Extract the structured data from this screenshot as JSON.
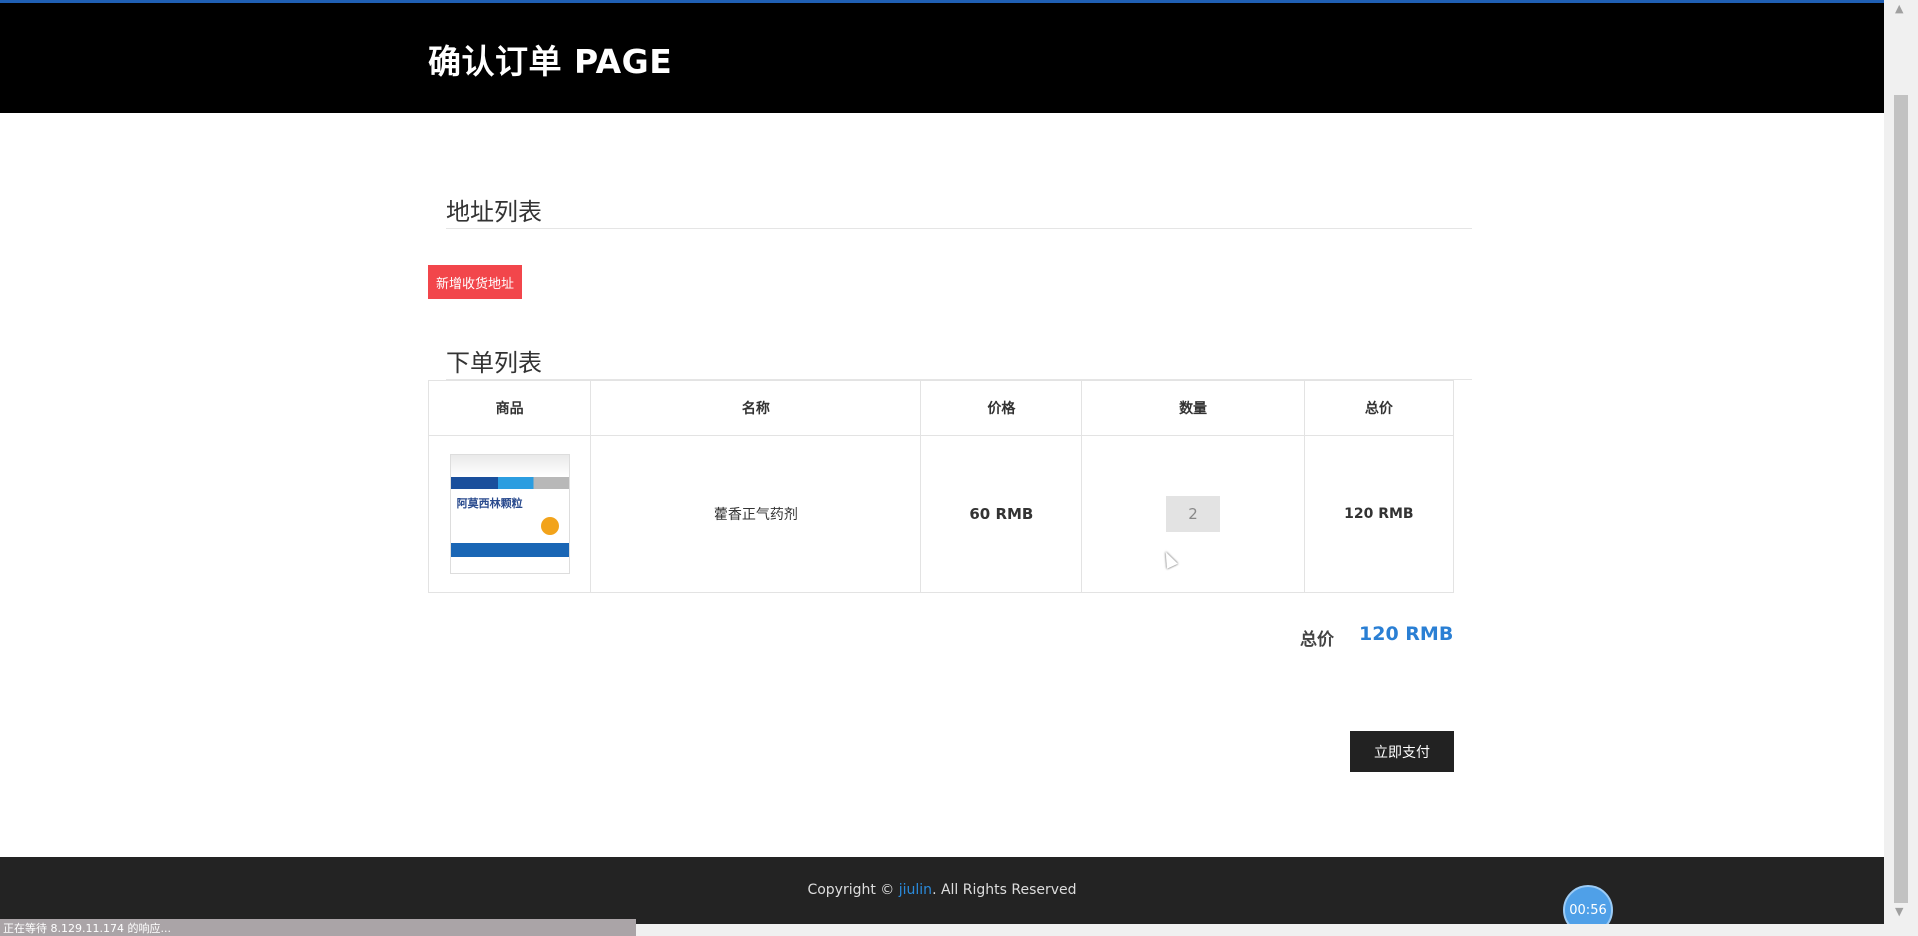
{
  "header": {
    "title": "确认订单 PAGE"
  },
  "address_section": {
    "title": "地址列表",
    "add_button": "新增收货地址"
  },
  "order_section": {
    "title": "下单列表",
    "columns": [
      "商品",
      "名称",
      "价格",
      "数量",
      "总价"
    ],
    "rows": [
      {
        "image_alt": "阿莫西林颗粒",
        "name": "藿香正气药剂",
        "price": "60 RMB",
        "quantity": "2",
        "total": "120 RMB"
      }
    ]
  },
  "summary": {
    "label": "总价",
    "value": "120 RMB"
  },
  "pay_button": "立即支付",
  "footer": {
    "prefix": "Copyright © ",
    "brand": "jiulin",
    "suffix": ". All Rights Reserved"
  },
  "timer": "00:56",
  "status_bar": "正在等待 8.129.11.174 的响应...",
  "colors": {
    "header_bg": "#000000",
    "accent": "#2a7fd4",
    "add_button": "#f2464b",
    "pay_button": "#222222"
  }
}
